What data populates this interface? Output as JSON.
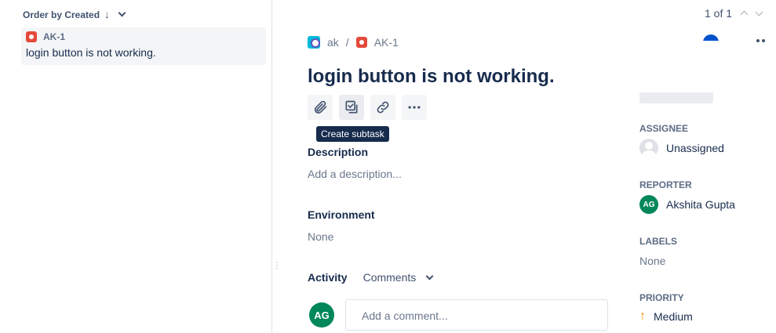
{
  "list": {
    "order_label": "Order by Created",
    "issues": [
      {
        "key": "AK-1",
        "summary": "login button is not working."
      }
    ]
  },
  "pager": {
    "text": "1 of 1"
  },
  "breadcrumb": {
    "project": "ak",
    "separator": "/",
    "issue_key": "AK-1"
  },
  "issue": {
    "title": "login button is not working.",
    "description_label": "Description",
    "description_placeholder": "Add a description...",
    "environment_label": "Environment",
    "environment_value": "None"
  },
  "toolbar": {
    "attach_icon": "paperclip-icon",
    "subtask_icon": "subtask-icon",
    "link_icon": "link-icon",
    "more_icon": "more-icon",
    "tooltip": "Create subtask"
  },
  "activity": {
    "label": "Activity",
    "filter": "Comments",
    "comment_avatar": "AG",
    "comment_placeholder": "Add a comment..."
  },
  "sidebar": {
    "assignee_label": "ASSIGNEE",
    "assignee_value": "Unassigned",
    "reporter_label": "REPORTER",
    "reporter_initials": "AG",
    "reporter_name": "Akshita Gupta",
    "labels_label": "LABELS",
    "labels_value": "None",
    "priority_label": "PRIORITY",
    "priority_value": "Medium"
  },
  "colors": {
    "bug": "#e5493a",
    "avatar": "#00875a",
    "priority_medium": "#ff8b00",
    "tooltip_bg": "#172b4d"
  }
}
